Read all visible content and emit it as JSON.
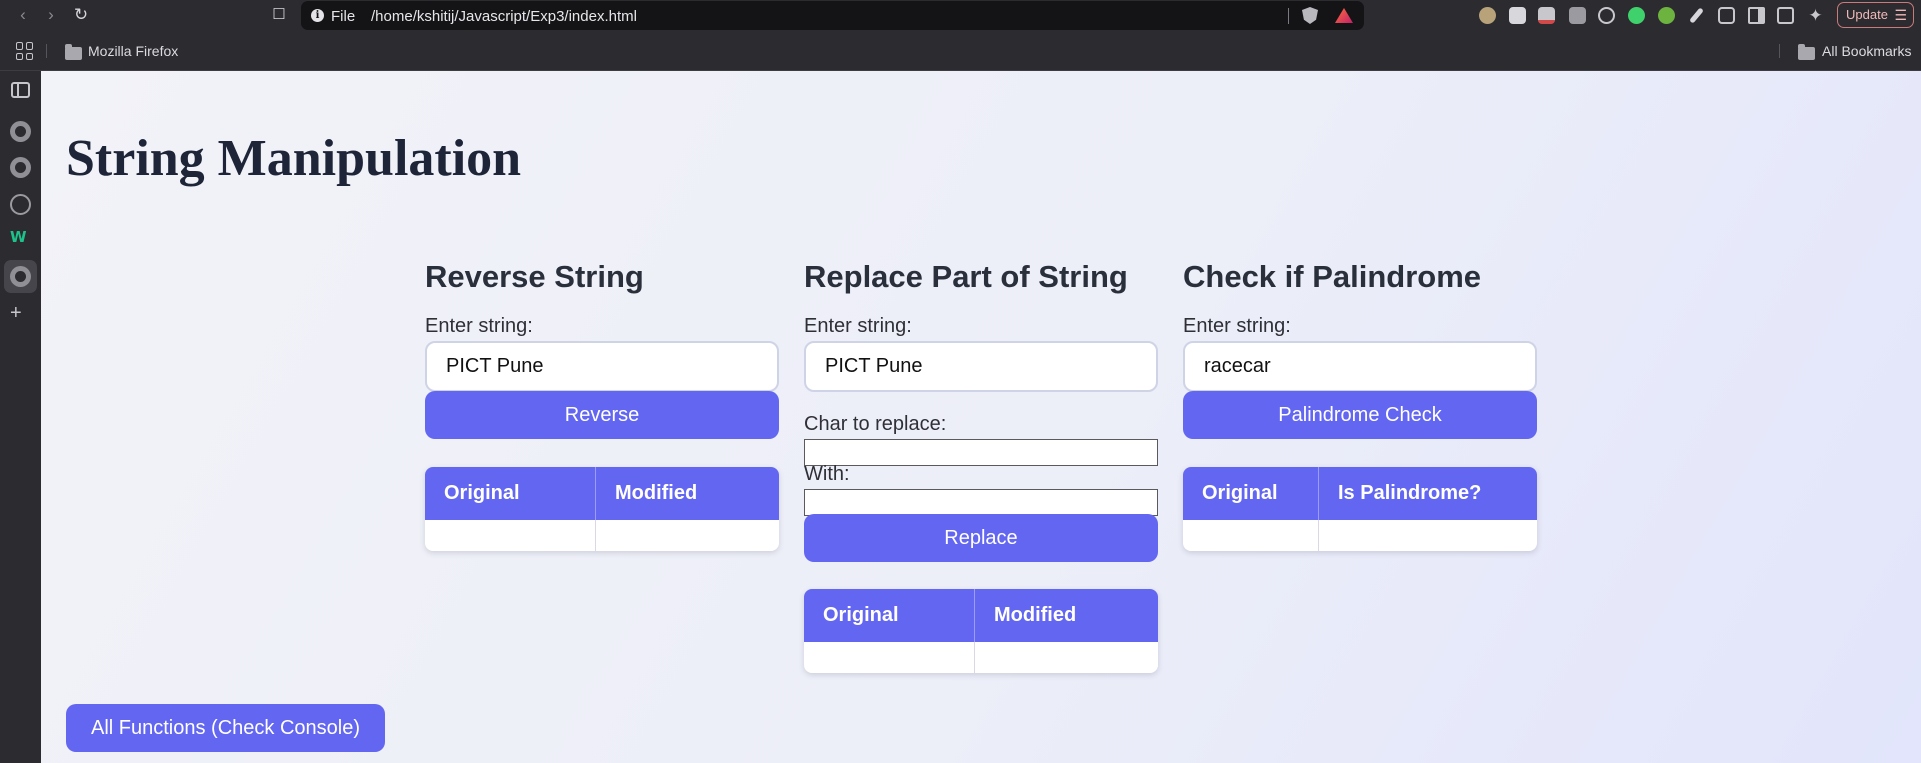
{
  "browser": {
    "url_scheme": "File",
    "url_path": "/home/kshitij/Javascript/Exp3/index.html",
    "update_label": "Update",
    "bookmarks": {
      "folder_label": "Mozilla Firefox",
      "all_label": "All Bookmarks"
    },
    "extension_icons": [
      "extension-icon",
      "extension-icon",
      "extension-icon",
      "extension-icon",
      "react-icon",
      "cursor-icon",
      "plus-circle-icon",
      "pen-icon",
      "puzzle-icon",
      "sidebar-toggle-icon",
      "wallet-icon",
      "sparkle-icon"
    ],
    "accent": "#6366f1"
  },
  "page": {
    "title": "String Manipulation",
    "reverse": {
      "heading": "Reverse String",
      "input_label": "Enter string:",
      "input_value": "PICT Pune",
      "button_label": "Reverse",
      "table_headers": [
        "Original",
        "Modified"
      ]
    },
    "replace": {
      "heading": "Replace Part of String",
      "input_label": "Enter string:",
      "input_value": "PICT Pune",
      "char_label": "Char to replace:",
      "char_value": "",
      "with_label": "With:",
      "with_value": "",
      "button_label": "Replace",
      "table_headers": [
        "Original",
        "Modified"
      ]
    },
    "palindrome": {
      "heading": "Check if Palindrome",
      "input_label": "Enter string:",
      "input_value": "racecar",
      "button_label": "Palindrome Check",
      "table_headers": [
        "Original",
        "Is Palindrome?"
      ]
    },
    "all_functions_label": "All Functions (Check Console)"
  }
}
